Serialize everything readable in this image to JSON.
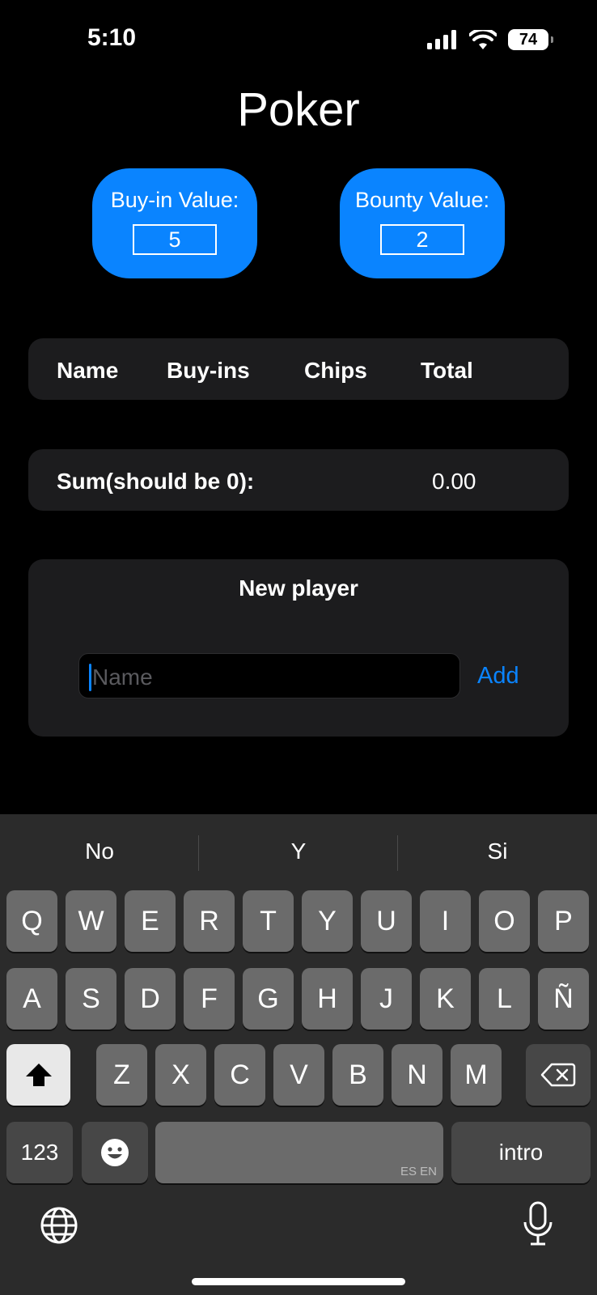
{
  "status": {
    "time": "5:10",
    "battery": "74"
  },
  "app": {
    "title": "Poker"
  },
  "buyin": {
    "label": "Buy-in Value:",
    "value": "5"
  },
  "bounty": {
    "label": "Bounty Value:",
    "value": "2"
  },
  "table": {
    "columns": [
      "Name",
      "Buy-ins",
      "Chips",
      "Total"
    ]
  },
  "sum": {
    "label": "Sum(should be 0):",
    "value": "0.00"
  },
  "new_player": {
    "title": "New player",
    "placeholder": "Name",
    "add_label": "Add"
  },
  "keyboard": {
    "suggestions": [
      "No",
      "Y",
      "Si"
    ],
    "row1": [
      "Q",
      "W",
      "E",
      "R",
      "T",
      "Y",
      "U",
      "I",
      "O",
      "P"
    ],
    "row2": [
      "A",
      "S",
      "D",
      "F",
      "G",
      "H",
      "J",
      "K",
      "L",
      "Ñ"
    ],
    "row3": [
      "Z",
      "X",
      "C",
      "V",
      "B",
      "N",
      "M"
    ],
    "numbers_label": "123",
    "space_hint": "ES EN",
    "return_label": "intro"
  }
}
